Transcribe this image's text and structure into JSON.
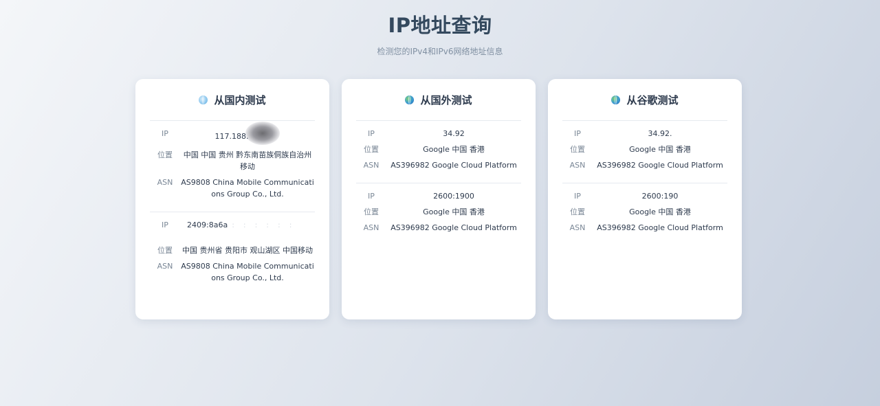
{
  "header": {
    "title": "IP地址查询",
    "subtitle": "检测您的IPv4和IPv6网络地址信息"
  },
  "labels": {
    "ip": "IP",
    "location": "位置",
    "asn": "ASN"
  },
  "cards": [
    {
      "title": "从国内测试",
      "icon": "globe-light-icon",
      "blocks": [
        {
          "ip": "117.188.",
          "location": "中国 中国 贵州 黔东南苗族侗族自治州 移动",
          "asn": "AS9808 China Mobile Communications Group Co., Ltd."
        },
        {
          "ip": "2409:8a6a",
          "location": "中国 贵州省 贵阳市 观山湖区 中国移动",
          "asn": "AS9808 China Mobile Communications Group Co., Ltd."
        }
      ]
    },
    {
      "title": "从国外测试",
      "icon": "globe-earth-icon",
      "blocks": [
        {
          "ip": "34.92",
          "location": "Google 中国 香港",
          "asn": "AS396982 Google Cloud Platform"
        },
        {
          "ip": "2600:1900",
          "location": "Google 中国 香港",
          "asn": "AS396982 Google Cloud Platform"
        }
      ]
    },
    {
      "title": "从谷歌测试",
      "icon": "globe-earth-icon",
      "blocks": [
        {
          "ip": "34.92.",
          "location": "Google 中国 香港",
          "asn": "AS396982 Google Cloud Platform"
        },
        {
          "ip": "2600:190",
          "location": "Google 中国 香港",
          "asn": "AS396982 Google Cloud Platform"
        }
      ]
    }
  ]
}
